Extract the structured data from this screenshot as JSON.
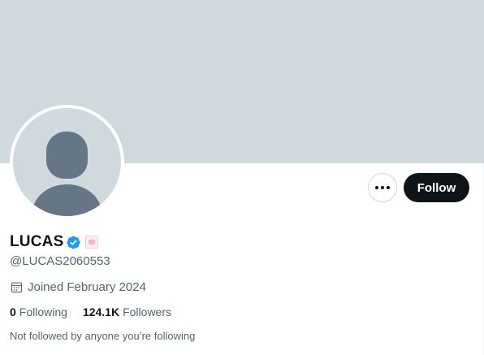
{
  "profile": {
    "display_name": "LUCAS",
    "handle": "@LUCAS2060553",
    "joined": "Joined February 2024",
    "following_count": "0",
    "following_label": "Following",
    "followers_count": "124.1K",
    "followers_label": "Followers",
    "not_followed_note": "Not followed by anyone you’re following"
  },
  "actions": {
    "follow_label": "Follow",
    "more_icon": "more-horizontal-icon"
  },
  "icons": {
    "verified": "verified-badge-icon",
    "affiliate": "affiliate-badge-icon",
    "calendar": "calendar-icon"
  },
  "colors": {
    "banner": "#cfd9de",
    "verified": "#1d9bf0",
    "follow_button": "#0f1419",
    "secondary_text": "#536471"
  }
}
